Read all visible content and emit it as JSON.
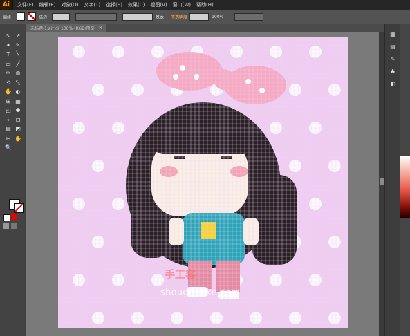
{
  "menubar": {
    "logo": "Ai",
    "items": [
      "文件(F)",
      "编辑(E)",
      "对象(O)",
      "文字(T)",
      "选择(S)",
      "效果(C)",
      "视图(V)",
      "窗口(W)",
      "帮助(H)"
    ]
  },
  "controlbar": {
    "label_object": "编组",
    "label_stroke": "描边",
    "label_opacity": "不透明度",
    "style_value": "基本",
    "zoom_value": "100%"
  },
  "document_tab": {
    "title": "未标题-1.ai* @ 100% (RGB/预览)",
    "close": "×"
  },
  "tools": [
    "↖",
    "↗",
    "✦",
    "✎",
    "T",
    "╲",
    "▭",
    "╱",
    "✏",
    "◍",
    "⟲",
    "⤡",
    "✋",
    "◐",
    "⊞",
    "▦",
    "◰",
    "✚",
    "⌖",
    "⊡",
    "▤",
    "◩",
    "✂",
    "✋",
    "🔍"
  ],
  "artboard": {
    "image_description_free": true,
    "colors": {
      "background": "#f0ccf0",
      "polka_dot": "#ffffff",
      "grid_line": "#e6d6f5",
      "hair": "#2a2025",
      "skin": "#fbeee5",
      "cheek": "#f4a5b3",
      "bow": "#f7a9c2",
      "bow_dot": "#ffffff",
      "shirt": "#2aa6b8",
      "shirt_print": "#f4d33a",
      "pants": "#e58aa1",
      "shoe": "#ffffff"
    }
  },
  "watermark": {
    "text": "shougongke.com",
    "logo_text": "手工客"
  }
}
